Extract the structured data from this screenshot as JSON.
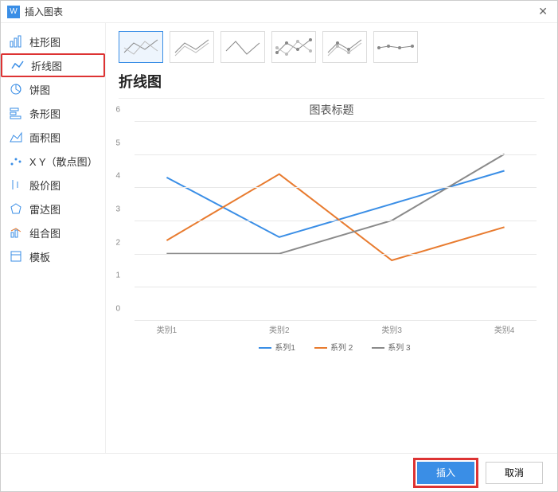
{
  "window": {
    "title": "插入图表"
  },
  "sidebar": {
    "items": [
      {
        "label": "柱形图"
      },
      {
        "label": "折线图",
        "selected": true
      },
      {
        "label": "饼图"
      },
      {
        "label": "条形图"
      },
      {
        "label": "面积图"
      },
      {
        "label": "X Y（散点图）"
      },
      {
        "label": "股价图"
      },
      {
        "label": "雷达图"
      },
      {
        "label": "组合图"
      },
      {
        "label": "模板"
      }
    ]
  },
  "main": {
    "type_title": "折线图",
    "thumbs_count": 6
  },
  "footer": {
    "insert_label": "插入",
    "cancel_label": "取消"
  },
  "chart_data": {
    "type": "line",
    "title": "图表标题",
    "categories": [
      "类别1",
      "类别2",
      "类别3",
      "类别4"
    ],
    "series": [
      {
        "name": "系列1",
        "color": "#3a8ee6",
        "values": [
          4.3,
          2.5,
          3.5,
          4.5
        ]
      },
      {
        "name": "系列 2",
        "color": "#e87b2f",
        "values": [
          2.4,
          4.4,
          1.8,
          2.8
        ]
      },
      {
        "name": "系列 3",
        "color": "#8a8a8a",
        "values": [
          2.0,
          2.0,
          3.0,
          5.0
        ]
      }
    ],
    "ylim": [
      0,
      6
    ],
    "yticks": [
      0,
      1,
      2,
      3,
      4,
      5,
      6
    ],
    "xlabel": "",
    "ylabel": ""
  }
}
